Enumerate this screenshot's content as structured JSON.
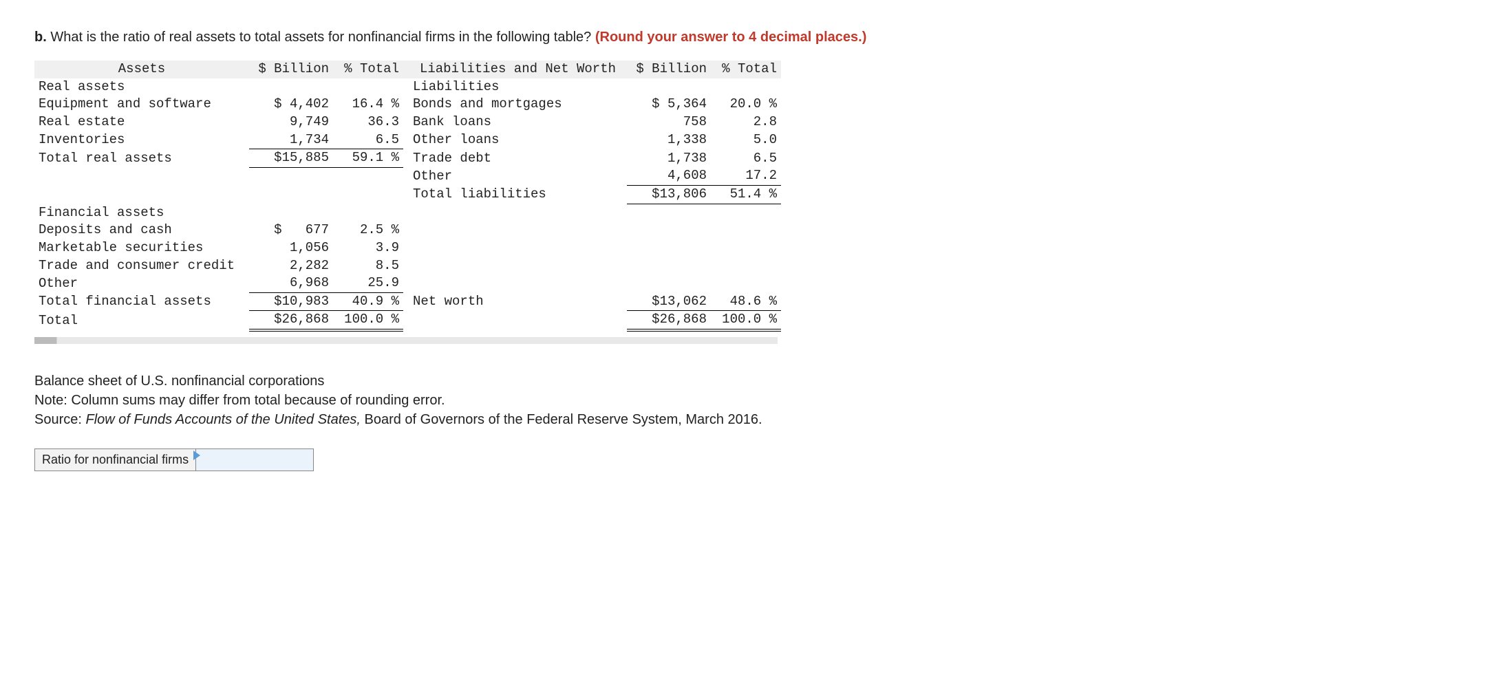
{
  "question": {
    "prefix_bold": "b.",
    "text": " What is the ratio of real assets to total assets for nonfinancial firms in the following table? ",
    "red": "(Round your answer to 4 decimal places.)"
  },
  "headers": {
    "left": "Assets",
    "left_bill": "$ Billion",
    "left_pct": "% Total",
    "right": "Liabilities and Net Worth",
    "right_bill": "$ Billion",
    "right_pct": "% Total"
  },
  "rows": [
    {
      "a": "Real assets",
      "ab": "",
      "ap": "",
      "l": "Liabilities",
      "lb": "",
      "lp": ""
    },
    {
      "a": "Equipment and software",
      "ab": "$ 4,402",
      "ap": "16.4 %",
      "l": "Bonds and mortgages",
      "lb": "$ 5,364",
      "lp": "20.0 %"
    },
    {
      "a": "Real estate",
      "ab": "9,749",
      "ap": "36.3",
      "l": "Bank loans",
      "lb": "758",
      "lp": "2.8"
    },
    {
      "a": "Inventories",
      "ab": "1,734",
      "ap": "6.5",
      "ab_u": true,
      "ap_u": true,
      "l": "Other loans",
      "lb": "1,338",
      "lp": "5.0"
    },
    {
      "a": "Total real assets",
      "ab": "$15,885",
      "ap": "59.1 %",
      "ab_u": true,
      "ap_u": true,
      "l": "Trade debt",
      "lb": "1,738",
      "lp": "6.5"
    },
    {
      "a": "",
      "ab": "",
      "ap": "",
      "l": "Other",
      "lb": "4,608",
      "lp": "17.2",
      "lb_u": true,
      "lp_u": true
    },
    {
      "a": "",
      "ab": "",
      "ap": "",
      "l": "Total liabilities",
      "lb": "$13,806",
      "lp": "51.4 %",
      "lb_u": true,
      "lp_u": true
    },
    {
      "a": "",
      "ab": "",
      "ap": "",
      "l": "",
      "lb": "",
      "lp": ""
    },
    {
      "a": "Financial assets",
      "ab": "",
      "ap": "",
      "l": "",
      "lb": "",
      "lp": ""
    },
    {
      "a": "Deposits and cash",
      "ab": "$   677",
      "ap": "2.5 %",
      "l": "",
      "lb": "",
      "lp": ""
    },
    {
      "a": "Marketable securities",
      "ab": "1,056",
      "ap": "3.9",
      "l": "",
      "lb": "",
      "lp": ""
    },
    {
      "a": "Trade and consumer credit",
      "ab": "2,282",
      "ap": "8.5",
      "l": "",
      "lb": "",
      "lp": ""
    },
    {
      "a": "Other",
      "ab": "6,968",
      "ap": "25.9",
      "ab_u": true,
      "ap_u": true,
      "l": "",
      "lb": "",
      "lp": ""
    },
    {
      "a": "Total financial assets",
      "ab": "$10,983",
      "ap": "40.9 %",
      "ab_u": true,
      "ap_u": true,
      "l": "Net worth",
      "lb": "$13,062",
      "lp": "48.6 %",
      "lb_u": true,
      "lp_u": true
    },
    {
      "a": "Total",
      "ab": "$26,868",
      "ap": "100.0 %",
      "ab_dbl": true,
      "ap_dbl": true,
      "l": "",
      "lb": "$26,868",
      "lp": "100.0 %",
      "lb_dbl": true,
      "lp_dbl": true
    }
  ],
  "footer": {
    "line1": "Balance sheet of U.S. nonfinancial corporations",
    "line2": "Note: Column sums may differ from total because of rounding error.",
    "line3a": "Source: ",
    "line3_italic": "Flow of Funds Accounts of the United States,",
    "line3b": " Board of Governors of the Federal Reserve System, March 2016."
  },
  "answer": {
    "label": "Ratio for nonfinancial firms",
    "value": ""
  }
}
